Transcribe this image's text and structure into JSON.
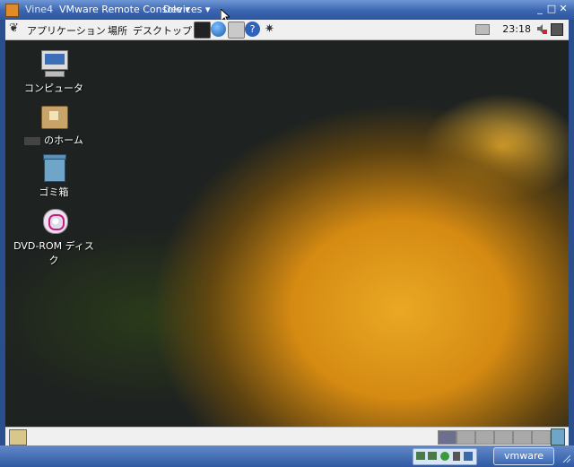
{
  "titlebar": {
    "title": "Vine4",
    "menu_remote_console": "VMware Remote Console",
    "menu_devices": "Devices"
  },
  "panel": {
    "menu_applications": "アプリケーション",
    "menu_places": "場所",
    "menu_desktop": "デスクトップ",
    "clock": "23:18"
  },
  "desktop_icons": {
    "computer": "コンピュータ",
    "home": "のホーム",
    "trash": "ゴミ箱",
    "dvd": "DVD-ROM ディスク"
  },
  "status": {
    "vmware_label": "vmware"
  },
  "colors": {
    "title_bar": "#3a65b0",
    "panel_bg": "#f0f0f0",
    "vmware_blue": "#2f5aa3"
  }
}
